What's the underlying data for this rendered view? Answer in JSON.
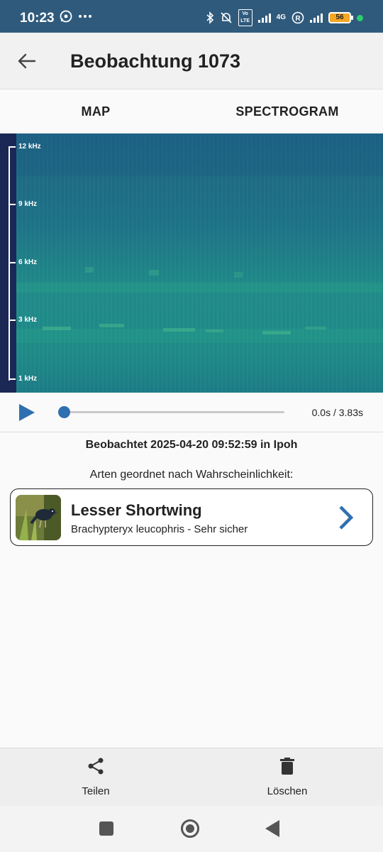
{
  "status_bar": {
    "time": "10:23",
    "network_type": "4G",
    "volte": "Vo LTE",
    "battery_level": "56",
    "accent_color": "#2f5a7c"
  },
  "app_bar": {
    "title": "Beobachtung 1073",
    "back_icon": "arrow-left-icon"
  },
  "tabs": [
    {
      "label": "MAP"
    },
    {
      "label": "SPECTROGRAM"
    }
  ],
  "spectrogram": {
    "frequency_labels": [
      "12 kHz",
      "9 kHz",
      "6 kHz",
      "3 kHz",
      "1 kHz"
    ]
  },
  "player": {
    "time_display": "0.0s / 3.83s",
    "progress": 0.0,
    "play_icon": "play-icon"
  },
  "observation": {
    "observed_text": "Beobachtet 2025-04-20 09:52:59 in Ipoh",
    "species_heading": "Arten geordnet nach Wahrscheinlichkeit:"
  },
  "species": [
    {
      "common_name": "Lesser Shortwing",
      "scientific_line": "Brachypteryx leucophris - Sehr sicher"
    }
  ],
  "actions": {
    "share_label": "Teilen",
    "delete_label": "Löschen"
  },
  "colors": {
    "accent": "#2f6fb0",
    "spectrogram_bg": "#1e6e84",
    "scale_bg": "#1b2855"
  }
}
